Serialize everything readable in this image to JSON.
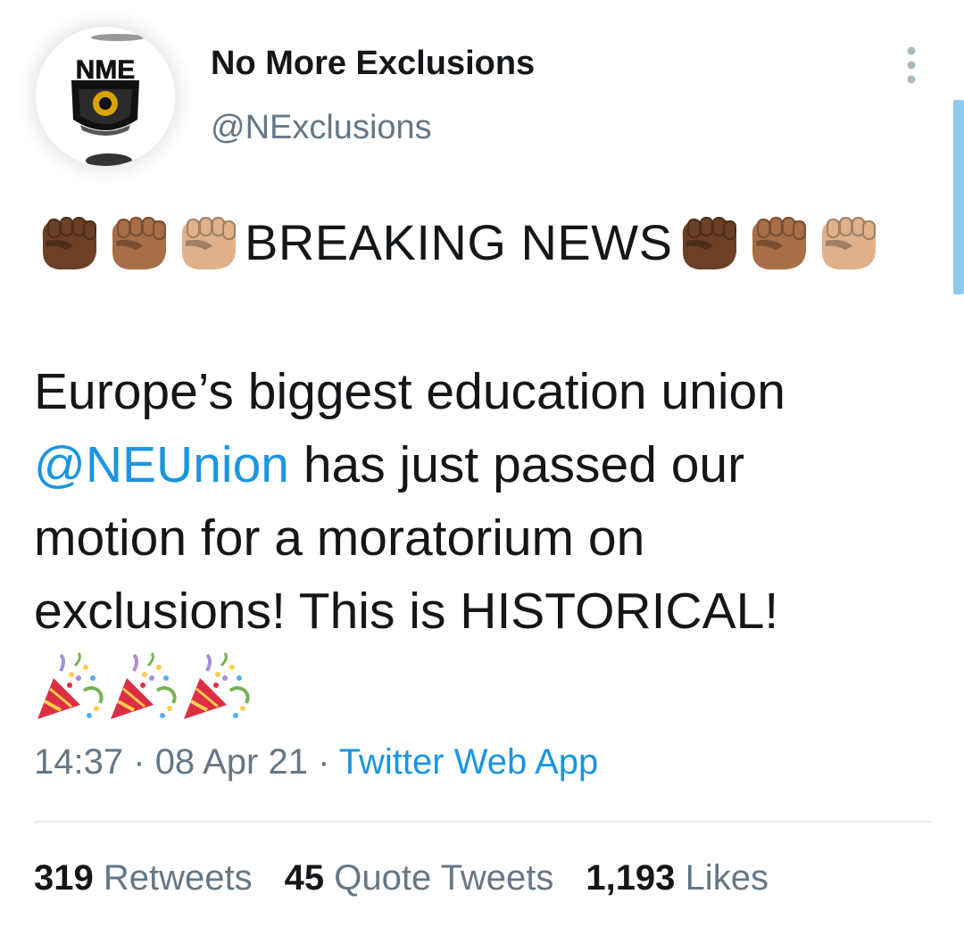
{
  "header": {
    "display_name": "No More Exclusions",
    "handle": "@NExclusions",
    "avatar_text": "NME"
  },
  "tweet": {
    "breaking_text": "BREAKING NEWS",
    "fist_emoji_tones": [
      "#6b4027",
      "#a86e45",
      "#e0b08a"
    ],
    "body_lines": {
      "line1": "Europe’s biggest education union",
      "mention": "@NEUnion",
      "line2_rest": " has just passed our",
      "line3": "motion for a moratorium on",
      "line4": "exclusions! This is HISTORICAL!"
    },
    "party_emoji_count": 3
  },
  "meta": {
    "time": "14:37",
    "date": "08 Apr 21",
    "source": "Twitter Web App",
    "separator": "·"
  },
  "stats": {
    "retweets_count": "319",
    "retweets_label": "Retweets",
    "quotes_count": "45",
    "quotes_label": "Quote Tweets",
    "likes_count": "1,193",
    "likes_label": "Likes"
  },
  "colors": {
    "accent": "#1b95e0",
    "text": "#14171a",
    "muted": "#657786"
  }
}
